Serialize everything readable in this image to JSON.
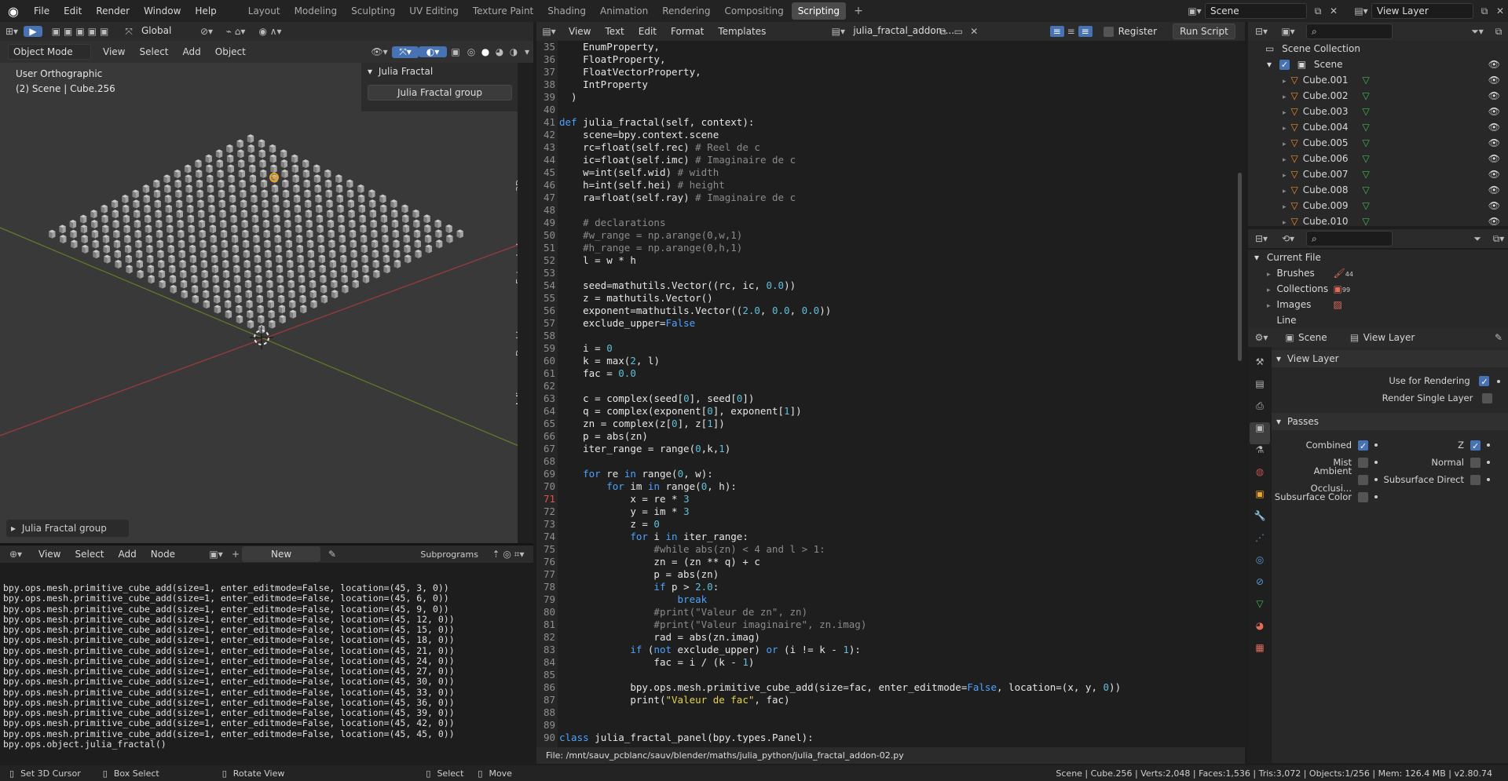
{
  "topbar": {
    "menus": [
      "File",
      "Edit",
      "Render",
      "Window",
      "Help"
    ],
    "workspaces": [
      "Layout",
      "Modeling",
      "Sculpting",
      "UV Editing",
      "Texture Paint",
      "Shading",
      "Animation",
      "Rendering",
      "Compositing",
      "Scripting"
    ],
    "active_workspace": "Scripting",
    "add_tab": "+",
    "scene_name": "Scene",
    "view_layer": "View Layer"
  },
  "viewport": {
    "mode": "Object Mode",
    "menus": [
      "View",
      "Select",
      "Add",
      "Object"
    ],
    "transform_orientation": "Global",
    "view_name": "User Orthographic",
    "view_subtitle": "(2) Scene | Cube.256",
    "panel_title": "Julia Fractal",
    "panel_button": "Julia Fractal group",
    "side_tabs": [
      "Item",
      "Tool",
      "View",
      "3D Printing",
      "Create",
      "Extended Tools",
      "AN",
      "Double cusp",
      "Julia Fractal"
    ],
    "operator_panel": "Julia Fractal group",
    "grid_cols": 20,
    "grid_rows": 20
  },
  "node_header": {
    "menus": [
      "View",
      "Select",
      "Add",
      "Node"
    ],
    "new_label": "New",
    "subprograms": "Subprograms"
  },
  "console": {
    "lines": [
      "bpy.ops.mesh.primitive_cube_add(size=1, enter_editmode=False, location=(45, 3, 0))",
      "bpy.ops.mesh.primitive_cube_add(size=1, enter_editmode=False, location=(45, 6, 0))",
      "bpy.ops.mesh.primitive_cube_add(size=1, enter_editmode=False, location=(45, 9, 0))",
      "bpy.ops.mesh.primitive_cube_add(size=1, enter_editmode=False, location=(45, 12, 0))",
      "bpy.ops.mesh.primitive_cube_add(size=1, enter_editmode=False, location=(45, 15, 0))",
      "bpy.ops.mesh.primitive_cube_add(size=1, enter_editmode=False, location=(45, 18, 0))",
      "bpy.ops.mesh.primitive_cube_add(size=1, enter_editmode=False, location=(45, 21, 0))",
      "bpy.ops.mesh.primitive_cube_add(size=1, enter_editmode=False, location=(45, 24, 0))",
      "bpy.ops.mesh.primitive_cube_add(size=1, enter_editmode=False, location=(45, 27, 0))",
      "bpy.ops.mesh.primitive_cube_add(size=1, enter_editmode=False, location=(45, 30, 0))",
      "bpy.ops.mesh.primitive_cube_add(size=1, enter_editmode=False, location=(45, 33, 0))",
      "bpy.ops.mesh.primitive_cube_add(size=1, enter_editmode=False, location=(45, 36, 0))",
      "bpy.ops.mesh.primitive_cube_add(size=1, enter_editmode=False, location=(45, 39, 0))",
      "bpy.ops.mesh.primitive_cube_add(size=1, enter_editmode=False, location=(45, 42, 0))",
      "bpy.ops.mesh.primitive_cube_add(size=1, enter_editmode=False, location=(45, 45, 0))",
      "bpy.ops.object.julia_fractal()"
    ]
  },
  "text_editor": {
    "menus": [
      "View",
      "Text",
      "Edit",
      "Format",
      "Templates"
    ],
    "filename": "julia_fractal_addon-...",
    "register_label": "Register",
    "run_script": "Run Script",
    "footer": "File: /mnt/sauv_pcblanc/sauv/blender/maths/julia_python/julia_fractal_addon-02.py",
    "first_line": 35,
    "current_line": 71,
    "code": [
      "    EnumProperty,",
      "    FloatProperty,",
      "    FloatVectorProperty,",
      "    IntProperty",
      "  )",
      "",
      "def julia_fractal(self, context):",
      "    scene=bpy.context.scene",
      "    rc=float(self.rec) # Reel de c",
      "    ic=float(self.imc) # Imaginaire de c",
      "    w=int(self.wid) # width",
      "    h=int(self.hei) # height",
      "    ra=float(self.ray) # Imaginaire de c",
      "",
      "    # declarations",
      "    #w_range = np.arange(0,w,1)",
      "    #h_range = np.arange(0,h,1)",
      "    l = w * h",
      "",
      "    seed=mathutils.Vector((rc, ic, 0.0))",
      "    z = mathutils.Vector()",
      "    exponent=mathutils.Vector((2.0, 0.0, 0.0))",
      "    exclude_upper=False",
      "",
      "    i = 0",
      "    k = max(2, l)",
      "    fac = 0.0",
      "",
      "    c = complex(seed[0], seed[0])",
      "    q = complex(exponent[0], exponent[1])",
      "    zn = complex(z[0], z[1])",
      "    p = abs(zn)",
      "    iter_range = range(0,k,1)",
      "",
      "    for re in range(0, w):",
      "        for im in range(0, h):",
      "            x = re * 3",
      "            y = im * 3",
      "            z = 0",
      "            for i in iter_range:",
      "                #while abs(zn) < 4 and l > 1:",
      "                zn = (zn ** q) + c",
      "                p = abs(zn)",
      "                if p > 2.0:",
      "                    break",
      "                #print(\"Valeur de zn\", zn)",
      "                #print(\"Valeur imaginaire\", zn.imag)",
      "                rad = abs(zn.imag)",
      "            if (not exclude_upper) or (i != k - 1):",
      "                fac = i / (k - 1)",
      "",
      "            bpy.ops.mesh.primitive_cube_add(size=fac, enter_editmode=False, location=(x, y, 0))",
      "            print(\"Valeur de fac\", fac)",
      "",
      "",
      "class julia_fractal_panel(bpy.types.Panel):"
    ]
  },
  "outliner": {
    "root": "Scene Collection",
    "scene": "Scene",
    "objects": [
      "Cube.001",
      "Cube.002",
      "Cube.003",
      "Cube.004",
      "Cube.005",
      "Cube.006",
      "Cube.007",
      "Cube.008",
      "Cube.009",
      "Cube.010"
    ]
  },
  "file_browser": {
    "root": "Current File",
    "items": [
      {
        "label": "Brushes",
        "count": "44"
      },
      {
        "label": "Collections",
        "count": "99"
      },
      {
        "label": "Images",
        "count": ""
      },
      {
        "label": "Line Styles",
        "count": ""
      }
    ]
  },
  "properties": {
    "scene": "Scene",
    "view_layer": "View Layer",
    "panel_view_layer": "View Layer",
    "use_for_rendering": "Use for Rendering",
    "render_single_layer": "Render Single Layer",
    "panel_passes": "Passes",
    "passes": [
      {
        "left": "Combined",
        "left_on": true,
        "right": "Z",
        "right_on": true
      },
      {
        "left": "Mist",
        "left_on": false,
        "right": "Normal",
        "right_on": false
      },
      {
        "left": "Ambient Occlusi...",
        "left_on": false,
        "right": "Subsurface Direct",
        "right_on": false
      },
      {
        "left": "Subsurface Color",
        "left_on": false,
        "right": "",
        "right_on": false
      }
    ]
  },
  "statusbar": {
    "set_cursor": "Set 3D Cursor",
    "box_select": "Box Select",
    "rotate_view": "Rotate View",
    "select": "Select",
    "move": "Move",
    "stats": "Scene | Cube.256 | Verts:2,048 | Faces:1,536 | Tris:3,072 | Objects:1/256 | Mem: 126.4 MB | v2.80.74"
  }
}
